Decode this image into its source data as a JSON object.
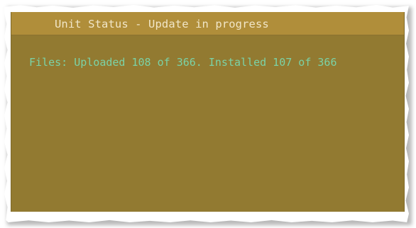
{
  "window": {
    "title": "Unit Status - Update in progress"
  },
  "status": {
    "files_line": "Files: Uploaded 108 of 366. Installed 107 of 366",
    "uploaded": 108,
    "installed": 107,
    "total": 366
  },
  "colors": {
    "header_bg": "#b08e3a",
    "panel_bg": "#927a31",
    "header_text": "#f1e6c8",
    "status_text": "#7bd2a6"
  }
}
